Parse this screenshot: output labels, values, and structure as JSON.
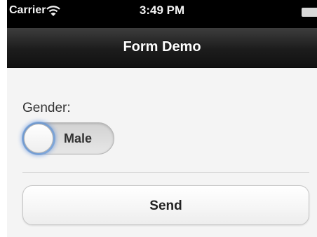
{
  "status_bar": {
    "carrier": "Carrier",
    "time": "3:49 PM",
    "icons": [
      "wifi-icon",
      "battery-icon"
    ]
  },
  "header": {
    "title": "Form Demo"
  },
  "form": {
    "gender_label": "Gender:",
    "gender_switch": {
      "value": "Male"
    },
    "send_label": "Send"
  },
  "colors": {
    "header_dark": "#1c1c1c",
    "page_background": "#f4f4f4",
    "focus_glow": "#3875d7"
  }
}
